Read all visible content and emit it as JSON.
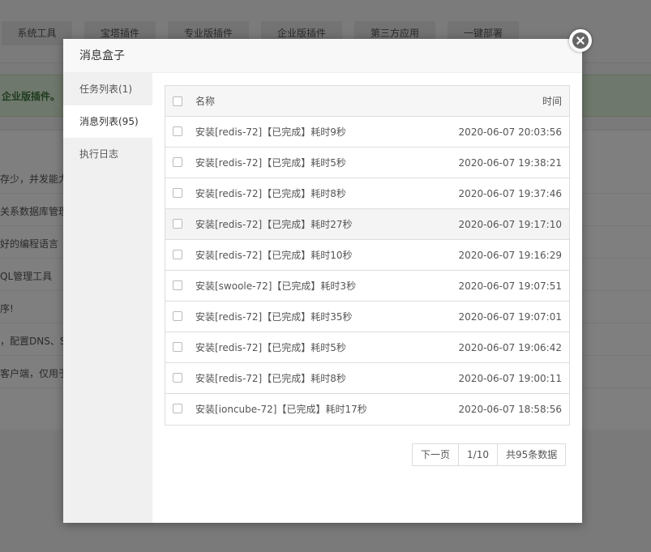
{
  "background": {
    "tabs": [
      "系统工具",
      "宝塔插件",
      "专业版插件",
      "企业版插件",
      "第三方应用",
      "一键部署"
    ],
    "banner_text": "企业版插件。",
    "rows": [
      "存少，并发能力",
      "关系数据库管理系",
      "好的编程语言",
      "QL管理工具",
      "序!",
      "，配置DNS、Sw",
      "客户端，仅用于"
    ]
  },
  "modal": {
    "title": "消息盒子",
    "sidebar": [
      {
        "label": "任务列表(1)",
        "active": false
      },
      {
        "label": "消息列表(95)",
        "active": true
      },
      {
        "label": "执行日志",
        "active": false
      }
    ],
    "table": {
      "headers": {
        "name": "名称",
        "time": "时间"
      },
      "rows": [
        {
          "name": "安装[redis-72]【已完成】耗时9秒",
          "time": "2020-06-07 20:03:56"
        },
        {
          "name": "安装[redis-72]【已完成】耗时5秒",
          "time": "2020-06-07 19:38:21"
        },
        {
          "name": "安装[redis-72]【已完成】耗时8秒",
          "time": "2020-06-07 19:37:46"
        },
        {
          "name": "安装[redis-72]【已完成】耗时27秒",
          "time": "2020-06-07 19:17:10"
        },
        {
          "name": "安装[redis-72]【已完成】耗时10秒",
          "time": "2020-06-07 19:16:29"
        },
        {
          "name": "安装[swoole-72]【已完成】耗时3秒",
          "time": "2020-06-07 19:07:51"
        },
        {
          "name": "安装[redis-72]【已完成】耗时35秒",
          "time": "2020-06-07 19:07:01"
        },
        {
          "name": "安装[redis-72]【已完成】耗时5秒",
          "time": "2020-06-07 19:06:42"
        },
        {
          "name": "安装[redis-72]【已完成】耗时8秒",
          "time": "2020-06-07 19:00:11"
        },
        {
          "name": "安装[ioncube-72]【已完成】耗时17秒",
          "time": "2020-06-07 18:58:56"
        }
      ]
    },
    "pager": {
      "next_label": "下一页",
      "page": "1/10",
      "total": "共95条数据"
    }
  }
}
